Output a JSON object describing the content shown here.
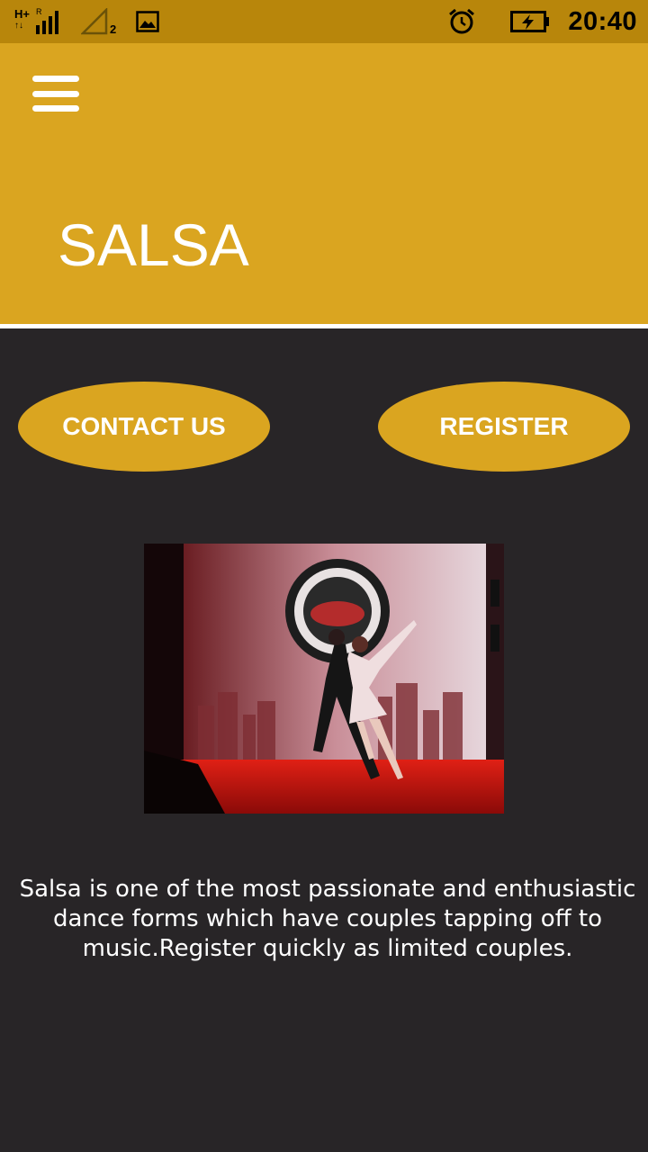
{
  "status_bar": {
    "network_type": "H+",
    "network_sub": "R",
    "sim_slot": "2",
    "time": "20:40",
    "icons": [
      "signal-icon",
      "signal-empty-icon",
      "gallery-icon",
      "alarm-icon",
      "battery-charging-icon"
    ]
  },
  "app_bar": {
    "title": "SALSA",
    "menu_icon": "hamburger-menu-icon"
  },
  "actions": {
    "contact_label": "CONTACT US",
    "register_label": "REGISTER"
  },
  "content": {
    "description": "Salsa is one of the most passionate and enthusiastic dance forms which have couples tapping off to music.Register quickly as limited couples."
  },
  "colors": {
    "status_bar": "#B8860B",
    "app_bar": "#DAA520",
    "background": "#282527",
    "button": "#DAA520",
    "text": "#FFFFFF"
  }
}
